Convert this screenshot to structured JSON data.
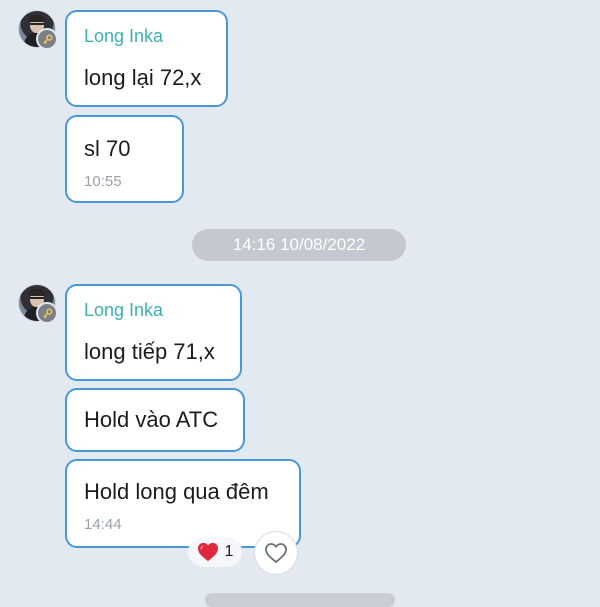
{
  "messages": [
    {
      "sender": "Long Inka",
      "bubbles": [
        {
          "text": "long lại 72,x"
        },
        {
          "text": "sl 70",
          "time": "10:55"
        }
      ]
    },
    {
      "sender": "Long Inka",
      "bubbles": [
        {
          "text": "long tiếp 71,x"
        },
        {
          "text": "Hold vào ATC"
        },
        {
          "text": "Hold long qua đêm",
          "time": "14:44"
        }
      ],
      "reaction": {
        "icon": "heart-icon",
        "count": "1"
      }
    }
  ],
  "date_separator": "14:16 10/08/2022",
  "colors": {
    "background": "#e3e9f1",
    "bubble_border": "#4a97d8",
    "sender_name": "#3eb0b4",
    "timestamp": "#9aa1a9",
    "date_pill": "#c4c9d0",
    "heart": "#e0283c"
  }
}
